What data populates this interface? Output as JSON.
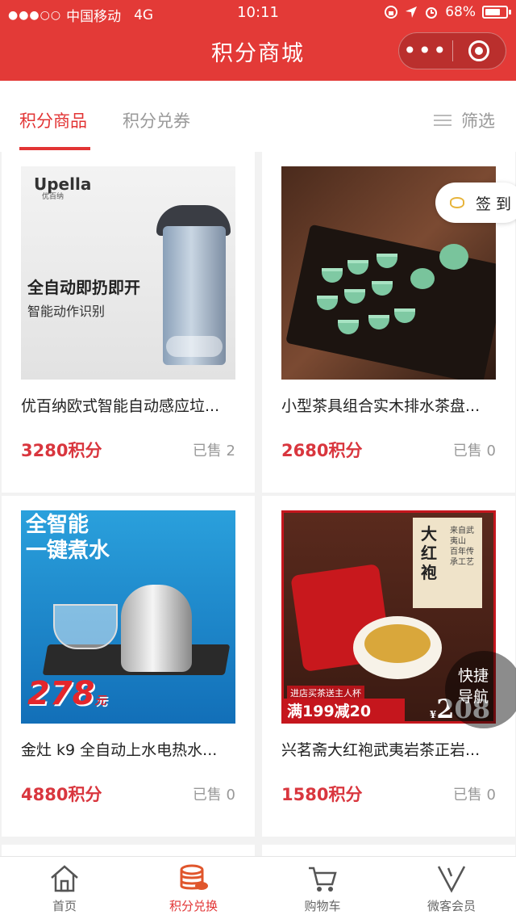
{
  "status_bar": {
    "signal_dots": "●●●○○",
    "carrier": "中国移动",
    "network": "4G",
    "time": "10:11",
    "battery": "68%"
  },
  "header": {
    "title": "积分商城",
    "more_icon": "more-dots-icon",
    "close_icon": "target-circle-icon",
    "bg_color": "#e33a37"
  },
  "tabs": {
    "items": [
      {
        "label": "积分商品",
        "active": true
      },
      {
        "label": "积分兑券",
        "active": false
      }
    ],
    "filter_label": "筛选",
    "accent": "#e23434"
  },
  "floating": {
    "signin_label": "签 到",
    "quick_nav_line1": "快捷",
    "quick_nav_line2": "导航"
  },
  "products": [
    {
      "name": "优百纳欧式智能自动感应垃...",
      "price": "3280积分",
      "sold": "已售 2",
      "image": {
        "brand": "Upella",
        "brand_sub": "优百纳",
        "slogan": "全自动即扔即开",
        "sub": "智能动作识别"
      }
    },
    {
      "name": "小型茶具组合实木排水茶盘...",
      "price": "2680积分",
      "sold": "已售 0",
      "image": {}
    },
    {
      "name": "金灶 k9 全自动上水电热水...",
      "price": "4880积分",
      "sold": "已售 0",
      "image": {
        "line1": "全智能",
        "line2": "一键煮水",
        "price": "278",
        "unit": "元"
      }
    },
    {
      "name": "兴茗斋大红袍武夷岩茶正岩...",
      "price": "1580积分",
      "sold": "已售 0",
      "image": {
        "tag_title": "大红袍",
        "tag_sub": "来自武夷山 百年传承工艺",
        "promo_small": "进店买茶送主人杯",
        "promo_big": "满199减20",
        "price_symbol": "¥",
        "price": "208"
      }
    }
  ],
  "bottom_tabs": [
    {
      "label": "首页",
      "icon": "home-icon",
      "active": false
    },
    {
      "label": "积分兑换",
      "icon": "coins-stack-icon",
      "active": true
    },
    {
      "label": "购物车",
      "icon": "cart-icon",
      "active": false
    },
    {
      "label": "微客会员",
      "icon": "v-member-icon",
      "active": false
    }
  ]
}
